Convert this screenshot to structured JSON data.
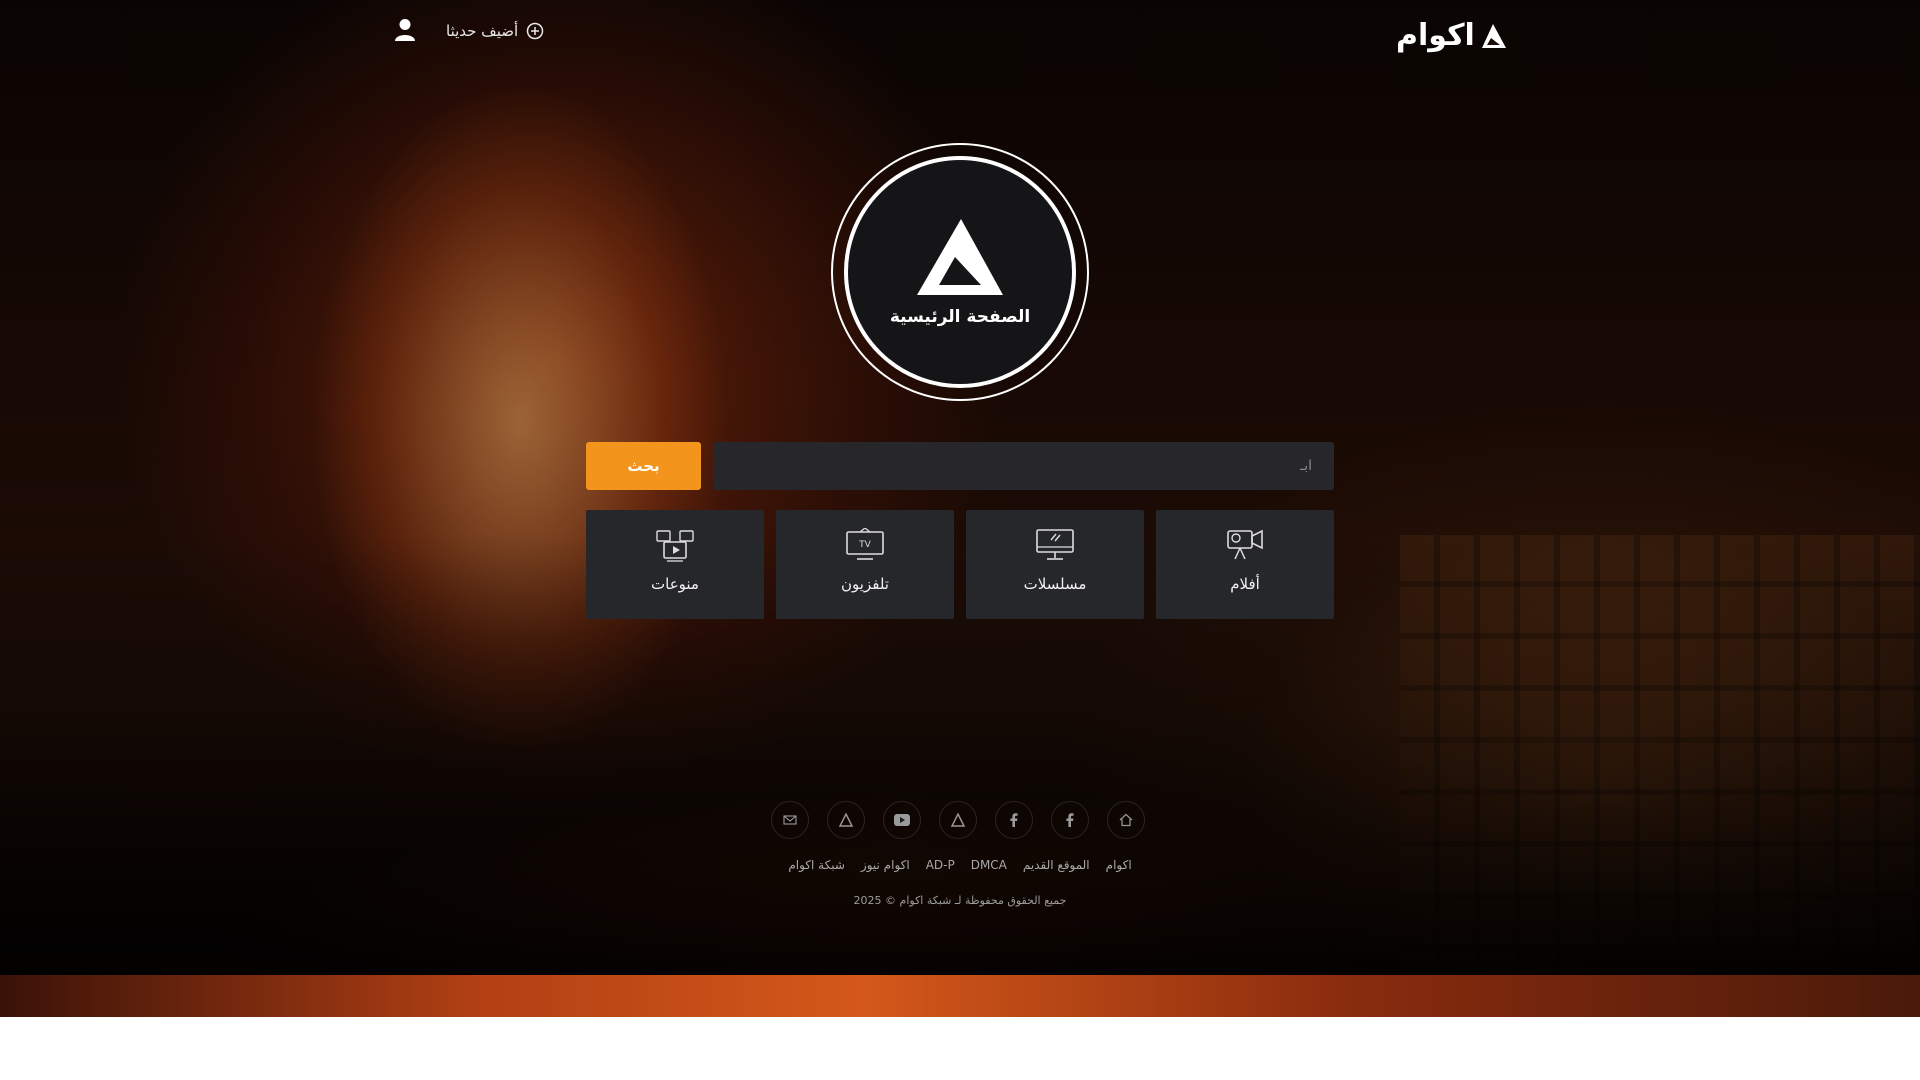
{
  "header": {
    "logo_text": "اكوام",
    "added_recently": "أضيف حديثا"
  },
  "hero": {
    "home_label": "الصفحة الرئيسية"
  },
  "search": {
    "placeholder": "ابـ",
    "button_label": "بحث"
  },
  "categories": [
    {
      "label": "أفلام",
      "icon": "movie-camera-icon"
    },
    {
      "label": "مسلسلات",
      "icon": "monitor-icon"
    },
    {
      "label": "تلفزيون",
      "icon": "tv-icon"
    },
    {
      "label": "منوعات",
      "icon": "media-collection-icon"
    }
  ],
  "social_icons": [
    "home-icon",
    "facebook-icon",
    "facebook-icon",
    "akwam-icon",
    "youtube-icon",
    "akwam-icon",
    "mail-icon"
  ],
  "footer": {
    "links": [
      "اكوام",
      "الموقع القديم",
      "DMCA",
      "AD-P",
      "اكوام نيوز",
      "شبكة اكوام"
    ],
    "copyright": "جميع الحقوق محفوظة لـ شبكة اكوام © 2025"
  },
  "colors": {
    "accent": "#f3951d",
    "card_bg": "#26272b",
    "input_bg": "#27272b",
    "circle_bg": "#151517"
  }
}
